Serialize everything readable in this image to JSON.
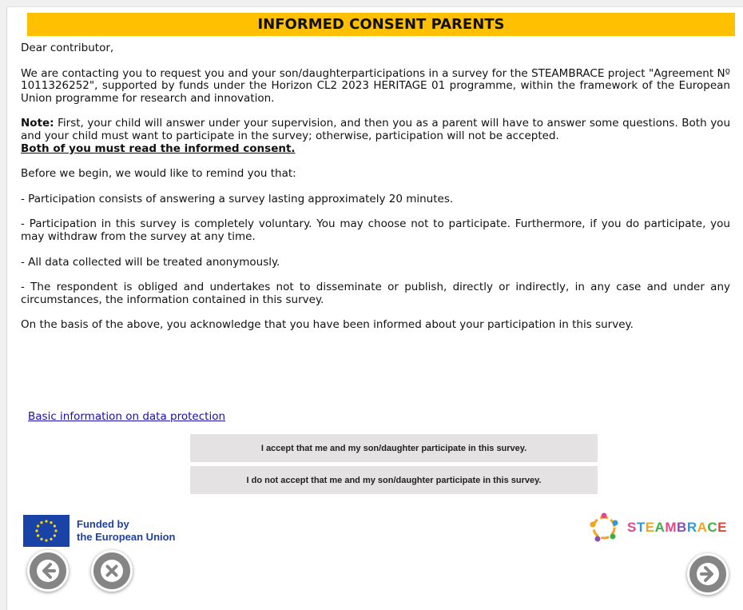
{
  "header": {
    "title": "INFORMED CONSENT PARENTS"
  },
  "body": {
    "greeting": "Dear contributor,",
    "intro": "We are contacting you to request you and your son/daughterparticipations in a survey for the STEAMBRACE project \"Agreement Nº 1011326252\", supported by funds under the Horizon CL2 2023 HERITAGE 01 programme, within the framework of the European Union programme for research and innovation.",
    "note_label": "Note:",
    "note_text": " First, your child will answer under your supervision, and then you as a parent will have to answer some questions. Both you and your child must want to participate in the survey; otherwise, participation will not be accepted.",
    "note_emphasis": "Both of you must read the informed consent. ",
    "reminder": "Before we begin, we would like to remind you that:",
    "points": [
      "- Participation consists of answering a survey lasting approximately 20 minutes.",
      "- Participation in this survey is completely voluntary. You may choose not to participate. Furthermore, if you do participate, you may withdraw from the survey at any time.",
      "- All data collected will be treated anonymously.",
      "- The respondent is obliged and undertakes not to disseminate or publish, directly or indirectly, in any case and under any circumstances, the information contained in this survey."
    ],
    "acknowledgement": "On the basis of the above, you acknowledge that you have been informed about your participation in this survey."
  },
  "link": {
    "data_protection": "Basic information on data protection"
  },
  "buttons": {
    "accept": "I accept that me and my son/daughter participate in this survey.",
    "decline": "I do not accept that me and my son/daughter participate in this survey."
  },
  "footer": {
    "eu_line1": "Funded by",
    "eu_line2": "the European Union",
    "steam_letters": [
      "S",
      "T",
      "E",
      "A",
      "M",
      "B",
      "R",
      "A",
      "C",
      "E"
    ],
    "steam_colors": [
      "#e04a8c",
      "#2f9bd6",
      "#f2a41c",
      "#3fae49",
      "#e04a8c",
      "#8a4fb5",
      "#2f9bd6",
      "#f2a41c",
      "#3fae49",
      "#e0463a"
    ]
  },
  "nav": {
    "back_icon": "arrow-left-icon",
    "close_icon": "close-icon",
    "next_icon": "arrow-right-icon"
  },
  "colors": {
    "title_bar": "#fec000",
    "eu_blue": "#1a43a8",
    "eu_star": "#ffdd00",
    "nav_button": "#858585",
    "link": "#1a0dab"
  }
}
